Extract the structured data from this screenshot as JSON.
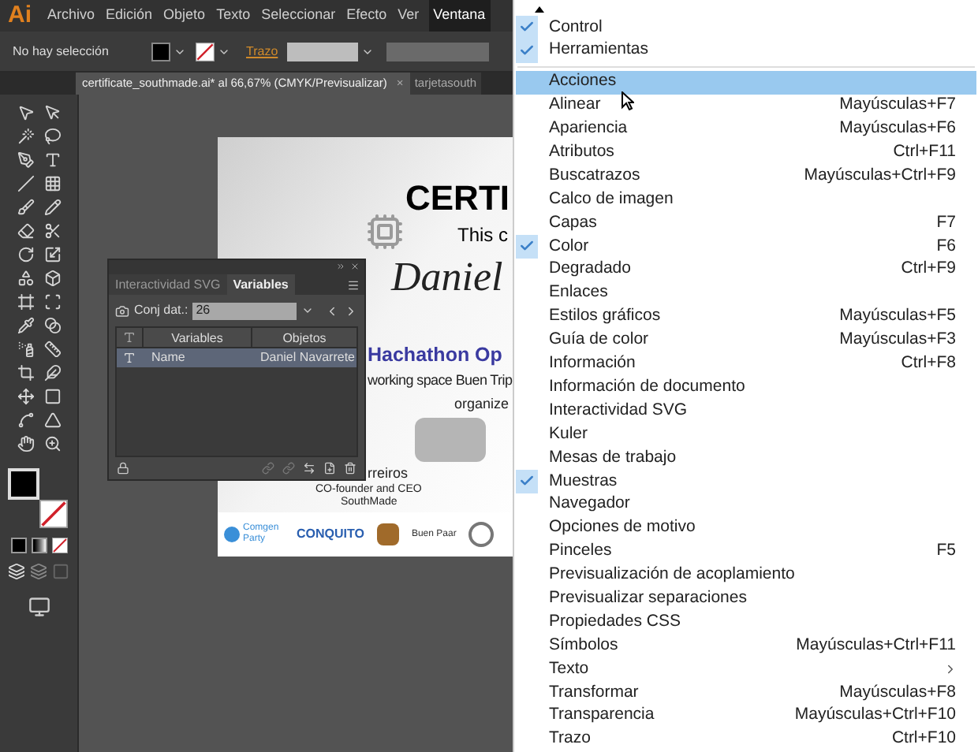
{
  "app": {
    "logo": "Ai"
  },
  "menubar": [
    {
      "label": "Archivo",
      "selected": false
    },
    {
      "label": "Edición",
      "selected": false
    },
    {
      "label": "Objeto",
      "selected": false
    },
    {
      "label": "Texto",
      "selected": false
    },
    {
      "label": "Seleccionar",
      "selected": false
    },
    {
      "label": "Efecto",
      "selected": false
    },
    {
      "label": "Ver",
      "selected": false
    },
    {
      "label": "Ventana",
      "selected": true
    }
  ],
  "control_bar": {
    "selection": "No hay selección",
    "stroke_label": "Trazo"
  },
  "document_tabs": [
    {
      "label": "certificate_southmade.ai* al 66,67% (CMYK/Previsualizar)",
      "selected": true,
      "close": "×"
    },
    {
      "label": "tarjetasouth",
      "selected": false
    }
  ],
  "artboard": {
    "title": "CERTI",
    "subtitle": "This c",
    "name": "Daniel",
    "event": "Hachathon Op",
    "venue": "working space Buen Trip",
    "organizer": "organize",
    "signer": "rreiros",
    "signer_role": "CO-founder and CEO",
    "signer_company": "SouthMade",
    "sponsors": [
      "Comgen Party",
      "CONQUITO",
      "Buen Paar"
    ]
  },
  "variables_panel": {
    "tabs": [
      {
        "label": "Interactividad SVG",
        "selected": false
      },
      {
        "label": "Variables",
        "selected": true
      }
    ],
    "dataset_label": "Conj dat.:",
    "dataset_value": "26",
    "columns": [
      "Variables",
      "Objetos"
    ],
    "rows": [
      {
        "name": "Name",
        "object": "Daniel Navarrete",
        "selected": true
      }
    ]
  },
  "window_menu": {
    "sections": [
      {
        "items": [
          {
            "label": "Control",
            "checked": true,
            "selected": false
          },
          {
            "label": "Herramientas",
            "checked": true,
            "selected": false
          }
        ]
      },
      {
        "items": [
          {
            "label": "Acciones",
            "checked": false,
            "selected": true
          },
          {
            "label": "Alinear",
            "shortcut": "Mayúsculas+F7",
            "checked": false,
            "selected": false
          },
          {
            "label": "Apariencia",
            "shortcut": "Mayúsculas+F6",
            "checked": false,
            "selected": false
          },
          {
            "label": "Atributos",
            "shortcut": "Ctrl+F11",
            "checked": false,
            "selected": false
          },
          {
            "label": "Buscatrazos",
            "shortcut": "Mayúsculas+Ctrl+F9",
            "checked": false,
            "selected": false
          },
          {
            "label": "Calco de imagen",
            "checked": false,
            "selected": false
          },
          {
            "label": "Capas",
            "shortcut": "F7",
            "checked": false,
            "selected": false
          },
          {
            "label": "Color",
            "shortcut": "F6",
            "checked": true,
            "selected": false
          },
          {
            "label": "Degradado",
            "shortcut": "Ctrl+F9",
            "checked": false,
            "selected": false
          },
          {
            "label": "Enlaces",
            "checked": false,
            "selected": false
          },
          {
            "label": "Estilos gráficos",
            "shortcut": "Mayúsculas+F5",
            "checked": false,
            "selected": false
          },
          {
            "label": "Guía de color",
            "shortcut": "Mayúsculas+F3",
            "checked": false,
            "selected": false
          },
          {
            "label": "Información",
            "shortcut": "Ctrl+F8",
            "checked": false,
            "selected": false
          },
          {
            "label": "Información de documento",
            "checked": false,
            "selected": false
          },
          {
            "label": "Interactividad SVG",
            "checked": false,
            "selected": false
          },
          {
            "label": "Kuler",
            "checked": false,
            "selected": false
          },
          {
            "label": "Mesas de trabajo",
            "checked": false,
            "selected": false
          },
          {
            "label": "Muestras",
            "checked": true,
            "selected": false
          },
          {
            "label": "Navegador",
            "checked": false,
            "selected": false
          },
          {
            "label": "Opciones de motivo",
            "checked": false,
            "selected": false
          },
          {
            "label": "Pinceles",
            "shortcut": "F5",
            "checked": false,
            "selected": false
          },
          {
            "label": "Previsualización de acoplamiento",
            "checked": false,
            "selected": false
          },
          {
            "label": "Previsualizar separaciones",
            "checked": false,
            "selected": false
          },
          {
            "label": "Propiedades CSS",
            "checked": false,
            "selected": false
          },
          {
            "label": "Símbolos",
            "shortcut": "Mayúsculas+Ctrl+F11",
            "checked": false,
            "selected": false
          },
          {
            "label": "Texto",
            "submenu": true,
            "checked": false,
            "selected": false
          },
          {
            "label": "Transformar",
            "shortcut": "Mayúsculas+F8",
            "checked": false,
            "selected": false
          },
          {
            "label": "Transparencia",
            "shortcut": "Mayúsculas+Ctrl+F10",
            "checked": false,
            "selected": false
          },
          {
            "label": "Trazo",
            "shortcut": "Ctrl+F10",
            "checked": false,
            "selected": false
          }
        ]
      }
    ]
  }
}
